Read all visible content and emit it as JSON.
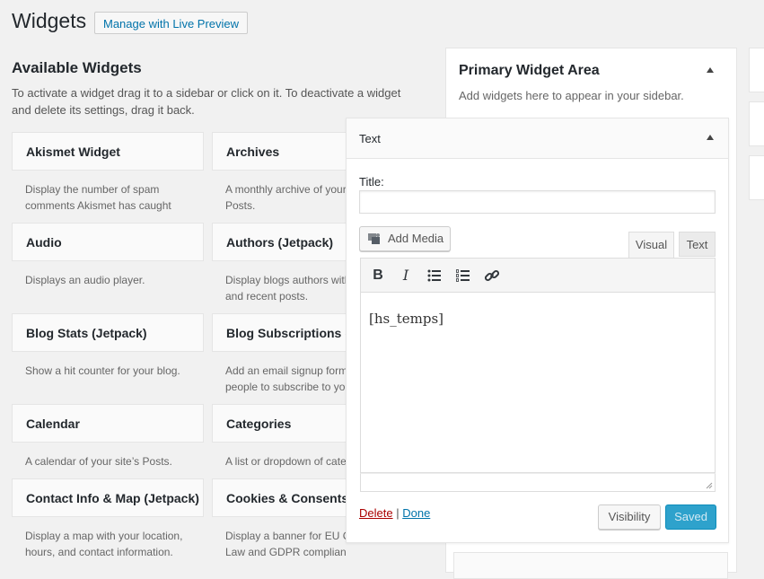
{
  "header": {
    "title": "Widgets",
    "live_preview": "Manage with Live Preview"
  },
  "available": {
    "title": "Available Widgets",
    "description": "To activate a widget drag it to a sidebar or click on it. To deactivate a widget and delete its settings, drag it back.",
    "left": [
      {
        "name": "Akismet Widget",
        "desc1": "Display the number of spam",
        "desc2": "comments Akismet has caught"
      },
      {
        "name": "Audio",
        "desc1": "Displays an audio player.",
        "desc2": ""
      },
      {
        "name": "Blog Stats (Jetpack)",
        "desc1": "Show a hit counter for your blog.",
        "desc2": ""
      },
      {
        "name": "Calendar",
        "desc1": "A calendar of your site’s Posts.",
        "desc2": ""
      },
      {
        "name": "Contact Info & Map (Jetpack)",
        "desc1": "Display a map with your location,",
        "desc2": "hours, and contact information."
      }
    ],
    "right": [
      {
        "name": "Archives",
        "desc1": "A monthly archive of your",
        "desc2": "Posts."
      },
      {
        "name": "Authors (Jetpack)",
        "desc1": "Display blogs authors with",
        "desc2": "and recent posts."
      },
      {
        "name": "Blog Subscriptions (Jetpack)",
        "desc1": "Add an email signup form",
        "desc2": "people to subscribe to your"
      },
      {
        "name": "Categories",
        "desc1": "A list or dropdown of categories",
        "desc2": ""
      },
      {
        "name": "Cookies & Consents Banner",
        "desc1": "Display a banner for EU Cookie",
        "desc2": "Law and GDPR compliance."
      }
    ]
  },
  "primary": {
    "title": "Primary Widget Area",
    "description": "Add widgets here to appear in your sidebar."
  },
  "text_widget": {
    "header": "Text",
    "title_label": "Title:",
    "title_value": "",
    "add_media": "Add Media",
    "tab_visual": "Visual",
    "tab_text": "Text",
    "toolbar": {
      "bold": "B",
      "italic": "I"
    },
    "content": "[hs_temps]",
    "delete": "Delete",
    "separator": "|",
    "done": "Done",
    "visibility": "Visibility",
    "saved": "Saved"
  },
  "colors": {
    "link": "#0073aa",
    "delete": "#a00",
    "saved_bg": "#2ea2cc"
  }
}
